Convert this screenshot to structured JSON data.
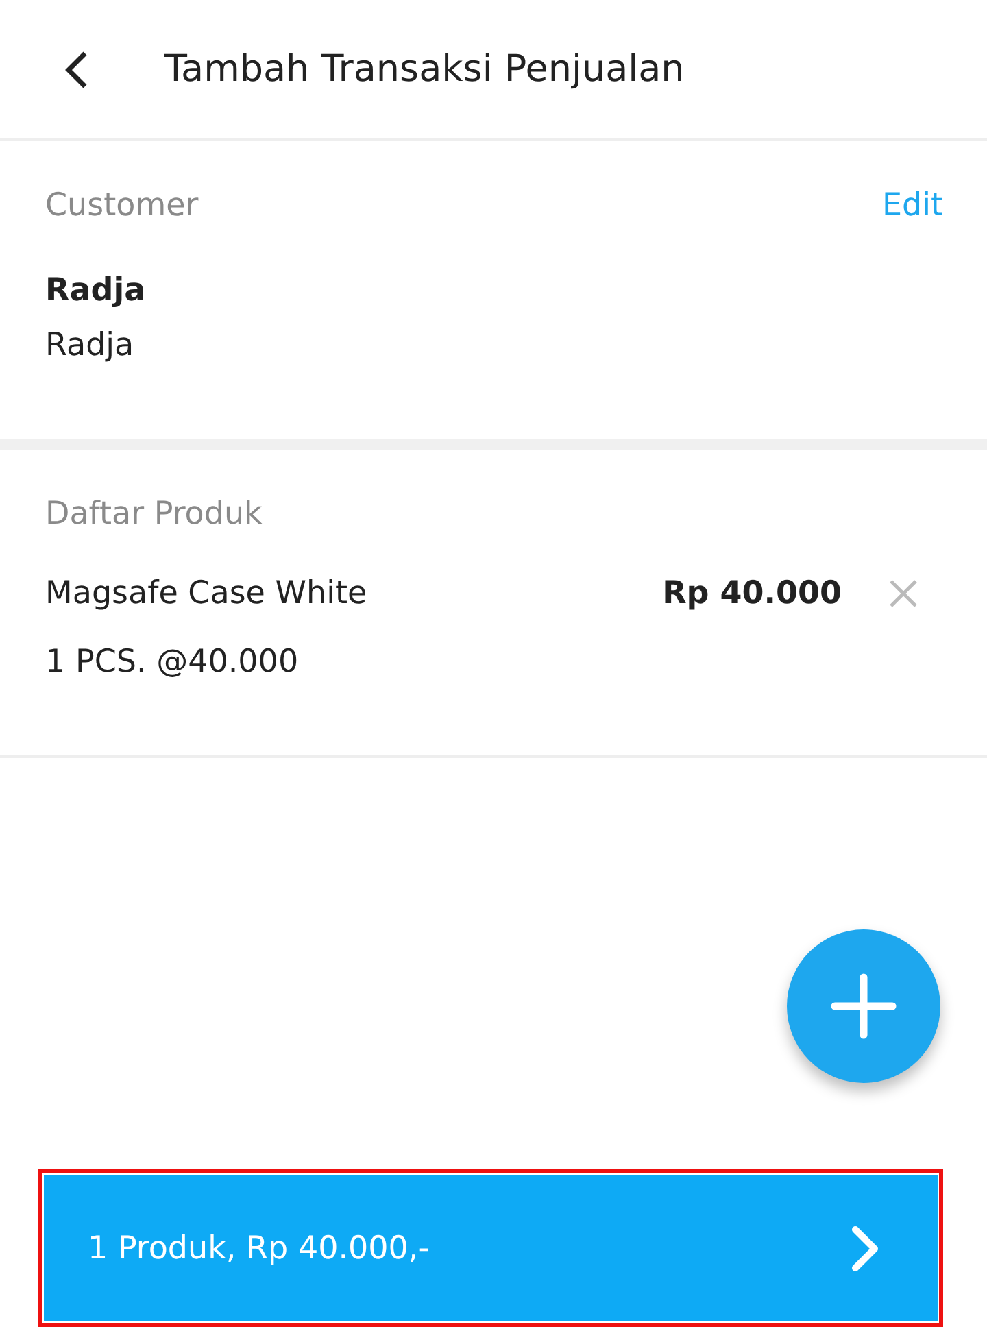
{
  "header": {
    "title": "Tambah Transaksi Penjualan"
  },
  "customer": {
    "label": "Customer",
    "action": "Edit",
    "name": "Radja",
    "detail": "Radja"
  },
  "products": {
    "label": "Daftar Produk",
    "items": [
      {
        "name": "Magsafe Case White",
        "price": "Rp 40.000",
        "quantity": "1 PCS. @40.000"
      }
    ]
  },
  "summary_button": {
    "label": "1 Produk, Rp 40.000,-",
    "highlighted": true
  }
}
